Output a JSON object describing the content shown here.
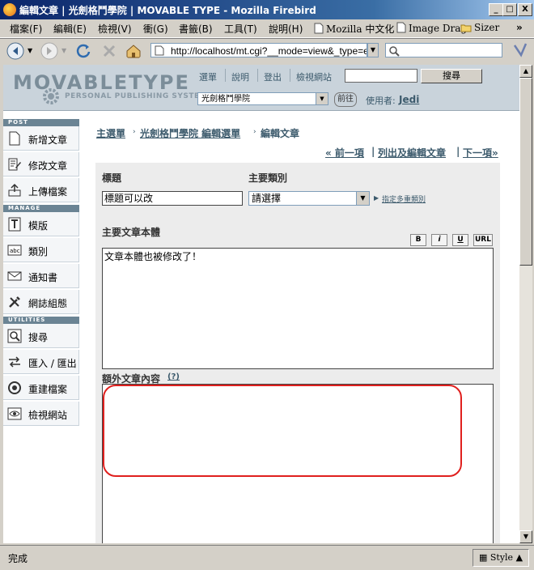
{
  "window": {
    "title": "編輯文章 | 光劍格鬥學院 | MOVABLE TYPE - Mozilla Firebird",
    "controls": {
      "minimize": "_",
      "maximize": "□",
      "close": "X"
    }
  },
  "menubar": {
    "items": [
      "檔案(F)",
      "編輯(E)",
      "檢視(V)",
      "衝(G)",
      "書籤(B)",
      "工具(T)",
      "說明(H)"
    ],
    "bookmarks": [
      "Mozilla 中文化",
      "Image Drag",
      "Sizer"
    ],
    "overflow": "»"
  },
  "navbar": {
    "url": "http://localhost/mt.cgi?__mode=view&_type=entry&",
    "search_value": ""
  },
  "header": {
    "logo_main": "MOVABLETYPE",
    "logo_sub": "PERSONAL PUBLISHING SYSTEM",
    "nav": [
      "選單",
      "說明",
      "登出",
      "檢視網站"
    ],
    "search_button": "搜尋",
    "search_value": "",
    "blog_select": "光劍格鬥學院",
    "go_button": "前往",
    "user_label": "使用者:",
    "user_name": "Jedi"
  },
  "sidebar": {
    "sections": [
      {
        "title": "POST",
        "items": [
          {
            "label": "新增文章",
            "icon": "new-document-icon"
          },
          {
            "label": "修改文章",
            "icon": "edit-document-icon"
          },
          {
            "label": "上傳檔案",
            "icon": "upload-icon"
          }
        ]
      },
      {
        "title": "MANAGE",
        "items": [
          {
            "label": "模版",
            "icon": "template-icon"
          },
          {
            "label": "類別",
            "icon": "category-icon"
          },
          {
            "label": "通知書",
            "icon": "envelope-icon"
          },
          {
            "label": "網誌組態",
            "icon": "tools-icon"
          }
        ]
      },
      {
        "title": "UTILITIES",
        "items": [
          {
            "label": "搜尋",
            "icon": "magnifier-icon"
          },
          {
            "label": "匯入 / 匯出",
            "icon": "import-export-icon"
          },
          {
            "label": "重建檔案",
            "icon": "rebuild-icon"
          },
          {
            "label": "檢視網站",
            "icon": "eye-icon"
          }
        ]
      }
    ]
  },
  "breadcrumb": {
    "items": [
      "主選單",
      "光劍格鬥學院 編輯選單",
      "編輯文章"
    ],
    "separator": "›"
  },
  "pagination": {
    "prev": "« 前一項",
    "list": "列出及編輯文章",
    "next": "下一項»",
    "divider": "|"
  },
  "form": {
    "title_label": "標題",
    "title_value": "標題可以改",
    "category_label": "主要類別",
    "category_value": "請選擇",
    "category_link": "指定多重類別",
    "body_label": "主要文章本體",
    "format_buttons": [
      "B",
      "i",
      "U",
      "URL"
    ],
    "body_value": "文章本體也被修改了！",
    "extended_label": "額外文章內容",
    "extended_help": "(?)",
    "extended_value": ""
  },
  "statusbar": {
    "text": "完成",
    "style_label": "Style"
  }
}
